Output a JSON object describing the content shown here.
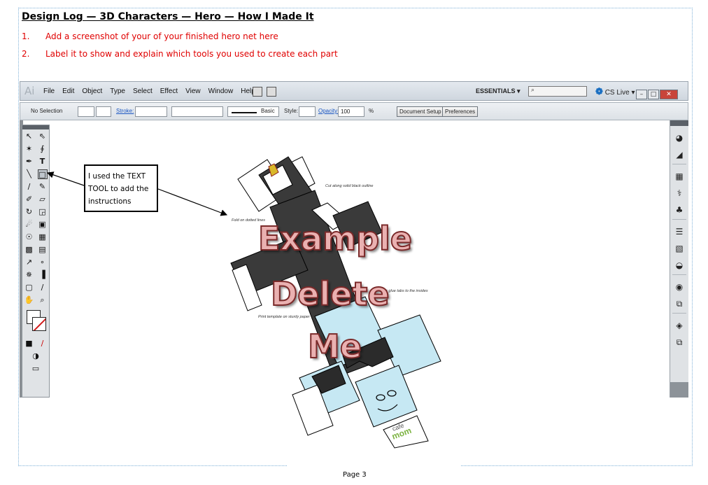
{
  "document": {
    "title": "Design Log — 3D Characters — Hero — How I Made It",
    "steps": [
      {
        "num": "1.",
        "text": "Add a screenshot of your of your finished hero net here"
      },
      {
        "num": "2.",
        "text": "Label it to show and explain which tools you used to create each part"
      }
    ],
    "page_label": "Page 3"
  },
  "illustrator": {
    "logo": "Ai",
    "menu": [
      "File",
      "Edit",
      "Object",
      "Type",
      "Select",
      "Effect",
      "View",
      "Window",
      "Help"
    ],
    "workspace": "ESSENTIALS ▾",
    "cs_live": "CS Live ▾",
    "window_buttons": [
      "–",
      "□",
      "✕"
    ],
    "control_bar": {
      "selection": "No Selection",
      "stroke_label": "Stroke:",
      "brush": "Basic",
      "style_label": "Style:",
      "opacity_label": "Opacity:",
      "opacity_value": "100",
      "percent": "%",
      "doc_setup": "Document Setup",
      "preferences": "Preferences"
    }
  },
  "callout": {
    "text": "I used the TEXT TOOL to add the instructions"
  },
  "template_notes": {
    "cut": "Cut along solid black outline",
    "fold": "Fold on dotted lines",
    "glue": "or glue tabs to the insides",
    "print": "Print template on sturdy paper"
  },
  "overlay": [
    "Example",
    "Delete",
    "Me"
  ],
  "logo_text": {
    "line1": "cafe",
    "line2": "mom"
  },
  "colors": {
    "body_dark": "#3a3a3a",
    "face_light_blue": "#c6e8f3",
    "instructions_red": "#e00000",
    "overlay_fill": "#eab1b1",
    "overlay_stroke": "#7b2a2a"
  },
  "icons": [
    "selection-tool-icon",
    "direct-selection-tool-icon",
    "pen-tool-icon",
    "type-tool-icon",
    "line-tool-icon",
    "rectangle-tool-icon",
    "paintbrush-tool-icon",
    "pencil-tool-icon",
    "hand-tool-icon",
    "zoom-tool-icon",
    "search-icon",
    "cs-live-icon"
  ]
}
